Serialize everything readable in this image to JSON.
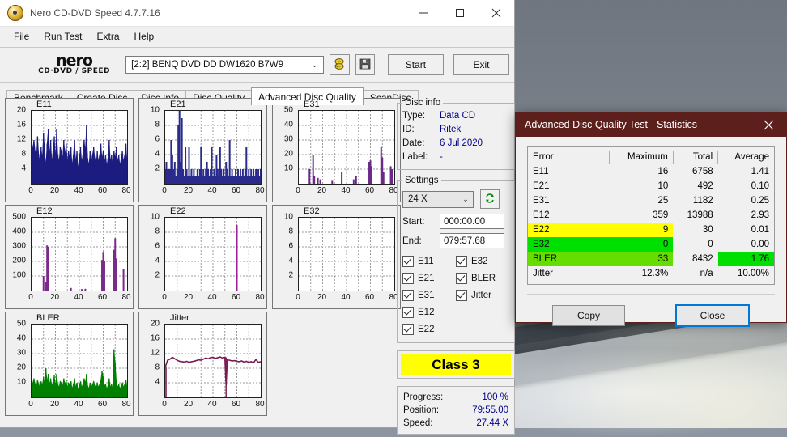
{
  "window": {
    "title": "Nero CD-DVD Speed 4.7.7.16",
    "icon": "nero-disc-icon",
    "minimize": "minimize-icon",
    "maximize": "maximize-icon",
    "close": "close-icon"
  },
  "menu": [
    "File",
    "Run Test",
    "Extra",
    "Help"
  ],
  "brand": {
    "line1": "nero",
    "line2": "CD·DVD ∕ SPEED"
  },
  "toolbar": {
    "drive": "[2:2]   BENQ DVD DD DW1620 B7W9",
    "drive_arrow": "⌄",
    "eject_icon": "eject-disc-icon",
    "save_icon": "floppy-save-icon",
    "start": "Start",
    "exit": "Exit"
  },
  "tabs": [
    {
      "label": "Benchmark",
      "active": false
    },
    {
      "label": "Create Disc",
      "active": false
    },
    {
      "label": "Disc Info",
      "active": false
    },
    {
      "label": "Disc Quality",
      "active": false
    },
    {
      "label": "Advanced Disc Quality",
      "active": true
    },
    {
      "label": "ScanDisc",
      "active": false
    }
  ],
  "disc_info": {
    "legend": "Disc info",
    "rows": [
      {
        "key": "Type:",
        "value": "Data CD"
      },
      {
        "key": "ID:",
        "value": "Ritek"
      },
      {
        "key": "Date:",
        "value": "6 Jul 2020"
      },
      {
        "key": "Label:",
        "value": "-"
      }
    ]
  },
  "settings": {
    "legend": "Settings",
    "speed": "24 X",
    "speed_arrow": "⌄",
    "refresh_icon": "refresh-green-icon",
    "start_label": "Start:",
    "start_value": "000:00.00",
    "end_label": "End:",
    "end_value": "079:57.68",
    "checkboxes_left": [
      {
        "label": "E11",
        "checked": true
      },
      {
        "label": "E21",
        "checked": true
      },
      {
        "label": "E31",
        "checked": true
      },
      {
        "label": "E12",
        "checked": true
      },
      {
        "label": "E22",
        "checked": true
      }
    ],
    "checkboxes_right": [
      {
        "label": "E32",
        "checked": true
      },
      {
        "label": "BLER",
        "checked": true
      },
      {
        "label": "Jitter",
        "checked": true
      }
    ]
  },
  "class_result": "Class 3",
  "progress": {
    "rows": [
      {
        "key": "Progress:",
        "value": "100 %"
      },
      {
        "key": "Position:",
        "value": "79:55.00"
      },
      {
        "key": "Speed:",
        "value": "27.44 X"
      }
    ]
  },
  "dialog": {
    "title": "Advanced Disc Quality Test - Statistics",
    "close_icon": "close-icon",
    "headers": [
      "Error",
      "Maximum",
      "Total",
      "Average"
    ],
    "rows": [
      {
        "error": "E11",
        "maximum": "16",
        "total": "6758",
        "average": "1.41",
        "highlight": "none"
      },
      {
        "error": "E21",
        "maximum": "10",
        "total": "492",
        "average": "0.10",
        "highlight": "none"
      },
      {
        "error": "E31",
        "maximum": "25",
        "total": "1182",
        "average": "0.25",
        "highlight": "none"
      },
      {
        "error": "E12",
        "maximum": "359",
        "total": "13988",
        "average": "2.93",
        "highlight": "none"
      },
      {
        "error": "E22",
        "maximum": "9",
        "total": "30",
        "average": "0.01",
        "highlight": "yellow"
      },
      {
        "error": "E32",
        "maximum": "0",
        "total": "0",
        "average": "0.00",
        "highlight": "green"
      },
      {
        "error": "BLER",
        "maximum": "33",
        "total": "8432",
        "average": "1.76",
        "highlight": "lime",
        "average_highlight": "green"
      },
      {
        "error": "Jitter",
        "maximum": "12.3%",
        "total": "n/a",
        "average": "10.00%",
        "highlight": "none"
      }
    ],
    "copy": "Copy",
    "close": "Close"
  },
  "colors": {
    "dialog_titlebar": "#5c1f1b",
    "highlight_yellow": "#ffff00",
    "highlight_green": "#00e000",
    "highlight_lime": "#66dd00",
    "e11_series": "#1c1c80",
    "e21_series": "#2b2b8c",
    "e31_series": "#6a2a8a",
    "e12_series": "#7a2a8a",
    "e22_series": "#9b1f9b",
    "bler_series": "#008000",
    "jitter_series": "#7d1a52",
    "value_text": "#00008b",
    "accent_focus": "#0078d7"
  },
  "chart_data": [
    {
      "type": "area",
      "title": "E11",
      "xlabel": "",
      "ylabel": "",
      "xlim": [
        0,
        80
      ],
      "ylim": [
        0,
        20
      ],
      "grid": true,
      "xticks": [
        0,
        20,
        40,
        60,
        80
      ],
      "yticks": [
        4,
        8,
        12,
        16,
        20
      ],
      "color": "#1c1c80",
      "x": [
        0,
        1,
        2,
        3,
        4,
        5,
        6,
        7,
        8,
        9,
        10,
        11,
        12,
        13,
        14,
        15,
        16,
        17,
        18,
        19,
        20,
        21,
        22,
        23,
        24,
        25,
        26,
        27,
        28,
        29,
        30,
        31,
        32,
        33,
        34,
        35,
        36,
        37,
        38,
        39,
        40,
        41,
        42,
        43,
        44,
        45,
        46,
        47,
        48,
        49,
        50,
        51,
        52,
        53,
        54,
        55,
        56,
        57,
        58,
        59,
        60,
        61,
        62,
        63,
        64,
        65,
        66,
        67,
        68,
        69,
        70,
        71,
        72,
        73,
        74,
        75,
        76,
        77,
        78,
        79,
        80
      ],
      "values": [
        8,
        10,
        12,
        9,
        7,
        13,
        8,
        6,
        10,
        7,
        14,
        9,
        5,
        11,
        15,
        8,
        12,
        6,
        9,
        13,
        7,
        15,
        8,
        6,
        10,
        9,
        7,
        12,
        8,
        11,
        6,
        9,
        7,
        10,
        5,
        8,
        12,
        6,
        9,
        4,
        7,
        10,
        6,
        8,
        12,
        9,
        16,
        7,
        5,
        9,
        6,
        8,
        10,
        7,
        5,
        9,
        6,
        8,
        11,
        7,
        9,
        6,
        8,
        5,
        7,
        12,
        6,
        8,
        5,
        9,
        7,
        10,
        6,
        8,
        5,
        7,
        9,
        6,
        8,
        11,
        6
      ]
    },
    {
      "type": "bar",
      "title": "E21",
      "xlabel": "",
      "ylabel": "",
      "xlim": [
        0,
        80
      ],
      "ylim": [
        0,
        10
      ],
      "grid": true,
      "xticks": [
        0,
        20,
        40,
        60,
        80
      ],
      "yticks": [
        2,
        4,
        6,
        8,
        10
      ],
      "color": "#2b2b8c",
      "x": [
        0,
        1,
        2,
        3,
        4,
        5,
        6,
        7,
        8,
        9,
        10,
        11,
        12,
        13,
        14,
        15,
        16,
        17,
        18,
        19,
        20,
        21,
        22,
        23,
        24,
        25,
        26,
        27,
        28,
        29,
        30,
        31,
        32,
        33,
        34,
        35,
        36,
        37,
        38,
        39,
        40,
        41,
        42,
        43,
        44,
        45,
        46,
        47,
        48,
        49,
        50,
        51,
        52,
        53,
        54,
        55,
        56,
        57,
        58,
        59,
        60,
        61,
        62,
        63,
        64,
        65,
        66,
        67,
        68,
        69,
        70,
        71,
        72,
        73,
        74,
        75,
        76,
        77,
        78,
        79,
        80
      ],
      "values": [
        2,
        3,
        2,
        2,
        2,
        6,
        4,
        2,
        3,
        1,
        2,
        8,
        10,
        3,
        9,
        2,
        1,
        5,
        2,
        1,
        5,
        1,
        2,
        1,
        2,
        1,
        1,
        2,
        1,
        2,
        5,
        1,
        2,
        1,
        2,
        3,
        2,
        1,
        2,
        5,
        1,
        2,
        1,
        4,
        2,
        1,
        5,
        2,
        1,
        2,
        1,
        3,
        2,
        1,
        6,
        1,
        2,
        1,
        1,
        2,
        1,
        2,
        1,
        2,
        1,
        2,
        1,
        2,
        5,
        1,
        2,
        1,
        2,
        1,
        2,
        1,
        2,
        1,
        2,
        1,
        2
      ]
    },
    {
      "type": "bar",
      "title": "E31",
      "xlabel": "",
      "ylabel": "",
      "xlim": [
        0,
        80
      ],
      "ylim": [
        0,
        50
      ],
      "grid": true,
      "xticks": [
        0,
        20,
        40,
        60,
        80
      ],
      "yticks": [
        10,
        20,
        30,
        40,
        50
      ],
      "color": "#6a2a8a",
      "x": [
        9,
        12,
        13,
        16,
        18,
        28,
        36,
        46,
        48,
        59,
        60,
        61,
        69,
        70,
        71,
        77,
        78
      ],
      "values": [
        10,
        20,
        5,
        4,
        3,
        2,
        8,
        3,
        5,
        15,
        16,
        12,
        25,
        18,
        8,
        12,
        10
      ]
    },
    {
      "type": "bar",
      "title": "E12",
      "xlabel": "",
      "ylabel": "",
      "xlim": [
        0,
        80
      ],
      "ylim": [
        0,
        500
      ],
      "grid": true,
      "xticks": [
        0,
        20,
        40,
        60,
        80
      ],
      "yticks": [
        100,
        200,
        300,
        400,
        500
      ],
      "color": "#7a2a8a",
      "x": [
        10,
        12,
        13,
        14,
        33,
        42,
        45,
        59,
        60,
        61,
        69,
        70,
        71,
        77
      ],
      "values": [
        100,
        60,
        310,
        300,
        18,
        10,
        12,
        210,
        260,
        200,
        280,
        359,
        220,
        150
      ]
    },
    {
      "type": "bar",
      "title": "E22",
      "xlabel": "",
      "ylabel": "",
      "xlim": [
        0,
        80
      ],
      "ylim": [
        0,
        10
      ],
      "grid": true,
      "xticks": [
        0,
        20,
        40,
        60,
        80
      ],
      "yticks": [
        2,
        4,
        6,
        8,
        10
      ],
      "color": "#9b1f9b",
      "x": [
        60
      ],
      "values": [
        9
      ]
    },
    {
      "type": "bar",
      "title": "E32",
      "xlabel": "",
      "ylabel": "",
      "xlim": [
        0,
        80
      ],
      "ylim": [
        0,
        10
      ],
      "grid": true,
      "xticks": [
        0,
        20,
        40,
        60,
        80
      ],
      "yticks": [
        2,
        4,
        6,
        8,
        10
      ],
      "color": "#9b1f9b",
      "x": [],
      "values": []
    },
    {
      "type": "area",
      "title": "BLER",
      "xlabel": "",
      "ylabel": "",
      "xlim": [
        0,
        80
      ],
      "ylim": [
        0,
        50
      ],
      "grid": true,
      "xticks": [
        0,
        20,
        40,
        60,
        80
      ],
      "yticks": [
        10,
        20,
        30,
        40,
        50
      ],
      "color": "#008000",
      "x": [
        0,
        1,
        2,
        3,
        4,
        5,
        6,
        7,
        8,
        9,
        10,
        11,
        12,
        13,
        14,
        15,
        16,
        17,
        18,
        19,
        20,
        21,
        22,
        23,
        24,
        25,
        26,
        27,
        28,
        29,
        30,
        31,
        32,
        33,
        34,
        35,
        36,
        37,
        38,
        39,
        40,
        41,
        42,
        43,
        44,
        45,
        46,
        47,
        48,
        49,
        50,
        51,
        52,
        53,
        54,
        55,
        56,
        57,
        58,
        59,
        60,
        61,
        62,
        63,
        64,
        65,
        66,
        67,
        68,
        69,
        70,
        71,
        72,
        73,
        74,
        75,
        76,
        77,
        78,
        79,
        80
      ],
      "values": [
        7,
        10,
        13,
        9,
        8,
        12,
        9,
        7,
        11,
        8,
        14,
        10,
        20,
        11,
        16,
        9,
        13,
        8,
        10,
        15,
        8,
        16,
        9,
        7,
        11,
        10,
        8,
        13,
        9,
        12,
        7,
        10,
        8,
        11,
        6,
        9,
        13,
        7,
        10,
        5,
        8,
        11,
        7,
        9,
        13,
        10,
        16,
        8,
        6,
        10,
        7,
        9,
        11,
        8,
        6,
        10,
        7,
        9,
        12,
        18,
        14,
        8,
        9,
        6,
        8,
        13,
        7,
        9,
        6,
        33,
        24,
        11,
        7,
        9,
        6,
        8,
        10,
        7,
        9,
        12,
        7
      ]
    },
    {
      "type": "line",
      "title": "Jitter",
      "xlabel": "",
      "ylabel": "",
      "xlim": [
        0,
        80
      ],
      "ylim": [
        0,
        20
      ],
      "grid": true,
      "xticks": [
        0,
        20,
        40,
        60,
        80
      ],
      "yticks": [
        4,
        8,
        12,
        16,
        20
      ],
      "color": "#7d1a52",
      "x": [
        0,
        2,
        4,
        6,
        8,
        10,
        12,
        14,
        16,
        18,
        20,
        22,
        24,
        26,
        28,
        30,
        32,
        34,
        36,
        38,
        40,
        42,
        44,
        46,
        48,
        50,
        51,
        52,
        54,
        56,
        58,
        60,
        62,
        64,
        66,
        68,
        70,
        72,
        74,
        76,
        78,
        80
      ],
      "values": [
        8.2,
        10.2,
        10.5,
        11.0,
        10.6,
        10.2,
        9.9,
        9.8,
        9.7,
        9.9,
        9.6,
        9.8,
        9.9,
        10.1,
        10.3,
        10.2,
        10.5,
        10.8,
        10.6,
        10.9,
        11.0,
        10.7,
        10.9,
        11.1,
        10.8,
        11.0,
        3.2,
        10.3,
        10.2,
        10.0,
        10.1,
        9.9,
        9.8,
        10.0,
        9.7,
        9.9,
        9.6,
        9.8,
        9.5,
        10.4,
        9.6,
        9.8
      ]
    }
  ]
}
